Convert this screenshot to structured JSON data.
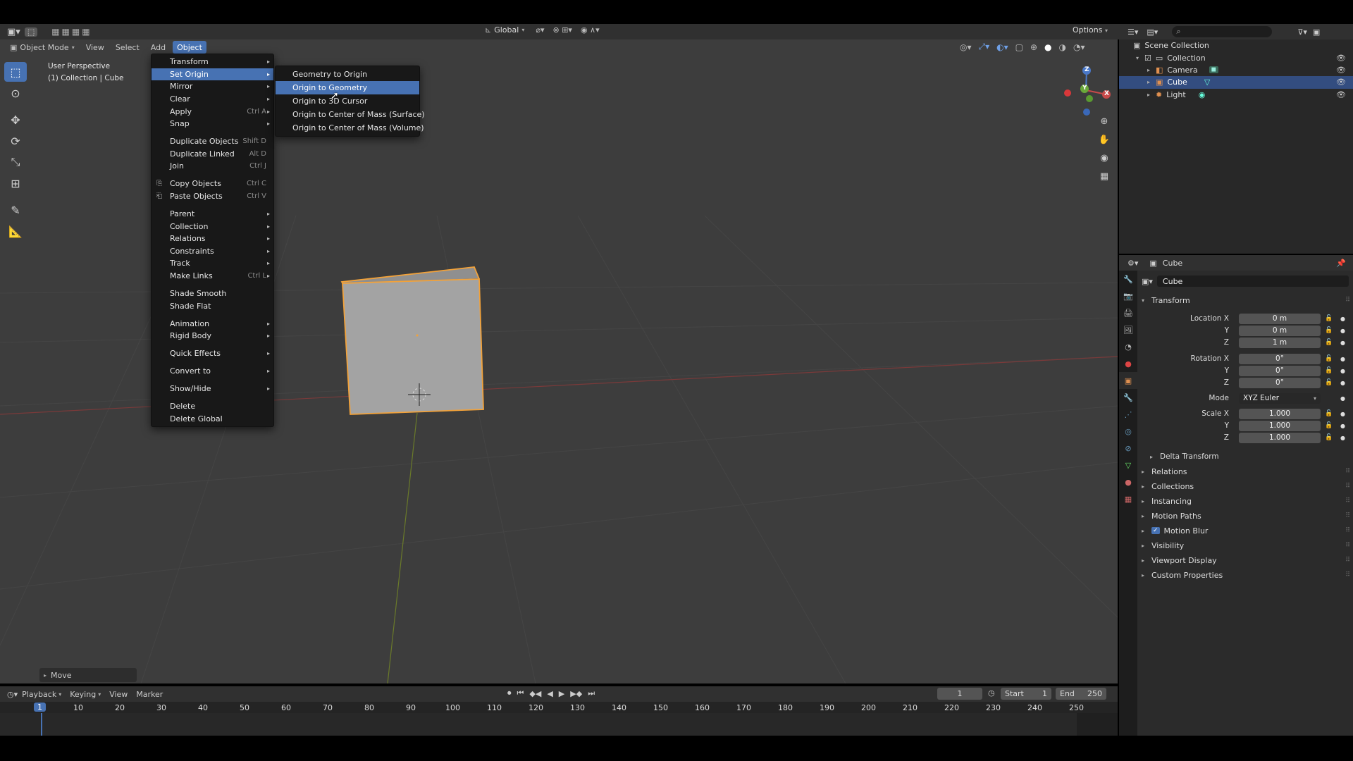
{
  "viewport": {
    "mode_label": "Object Mode",
    "menus": [
      "View",
      "Select",
      "Add",
      "Object"
    ],
    "transform_orientation": "Global",
    "options_label": "Options",
    "overlay_line1": "User Perspective",
    "overlay_line2": "(1) Collection | Cube",
    "last_operator": "Move",
    "gizmo_axes": {
      "x": "X",
      "y": "Y",
      "z": "Z"
    }
  },
  "object_menu": {
    "items": [
      {
        "label": "Transform",
        "shortcut": "",
        "submenu": true
      },
      {
        "label": "Set Origin",
        "shortcut": "",
        "submenu": true,
        "highlighted": true
      },
      {
        "label": "Mirror",
        "shortcut": "",
        "submenu": true
      },
      {
        "label": "Clear",
        "shortcut": "",
        "submenu": true
      },
      {
        "label": "Apply",
        "shortcut": "Ctrl A",
        "submenu": true
      },
      {
        "label": "Snap",
        "shortcut": "",
        "submenu": true
      },
      {
        "label": "Duplicate Objects",
        "shortcut": "Shift D"
      },
      {
        "label": "Duplicate Linked",
        "shortcut": "Alt D"
      },
      {
        "label": "Join",
        "shortcut": "Ctrl J"
      },
      {
        "label": "Copy Objects",
        "shortcut": "Ctrl C"
      },
      {
        "label": "Paste Objects",
        "shortcut": "Ctrl V"
      },
      {
        "label": "Parent",
        "shortcut": "",
        "submenu": true
      },
      {
        "label": "Collection",
        "shortcut": "",
        "submenu": true
      },
      {
        "label": "Relations",
        "shortcut": "",
        "submenu": true
      },
      {
        "label": "Constraints",
        "shortcut": "",
        "submenu": true
      },
      {
        "label": "Track",
        "shortcut": "",
        "submenu": true
      },
      {
        "label": "Make Links",
        "shortcut": "Ctrl L",
        "submenu": true
      },
      {
        "label": "Shade Smooth",
        "shortcut": ""
      },
      {
        "label": "Shade Flat",
        "shortcut": ""
      },
      {
        "label": "Animation",
        "shortcut": "",
        "submenu": true
      },
      {
        "label": "Rigid Body",
        "shortcut": "",
        "submenu": true
      },
      {
        "label": "Quick Effects",
        "shortcut": "",
        "submenu": true
      },
      {
        "label": "Convert to",
        "shortcut": "",
        "submenu": true
      },
      {
        "label": "Show/Hide",
        "shortcut": "",
        "submenu": true
      },
      {
        "label": "Delete",
        "shortcut": ""
      },
      {
        "label": "Delete Global",
        "shortcut": ""
      }
    ]
  },
  "set_origin_menu": {
    "items": [
      {
        "label": "Geometry to Origin"
      },
      {
        "label": "Origin to Geometry",
        "highlighted": true
      },
      {
        "label": "Origin to 3D Cursor"
      },
      {
        "label": "Origin to Center of Mass (Surface)"
      },
      {
        "label": "Origin to Center of Mass (Volume)"
      }
    ]
  },
  "outliner": {
    "root": "Scene Collection",
    "collection": "Collection",
    "objects": [
      {
        "label": "Camera",
        "selected": false
      },
      {
        "label": "Cube",
        "selected": true
      },
      {
        "label": "Light",
        "selected": false
      }
    ]
  },
  "properties": {
    "header_object": "Cube",
    "name_field": "Cube",
    "transform_panel": "Transform",
    "location_label": "Location X",
    "rotation_label": "Rotation X",
    "scale_label": "Scale X",
    "y_label": "Y",
    "z_label": "Z",
    "mode_label": "Mode",
    "location": [
      "0 m",
      "0 m",
      "1 m"
    ],
    "rotation": [
      "0°",
      "0°",
      "0°"
    ],
    "rotation_mode": "XYZ Euler",
    "scale": [
      "1.000",
      "1.000",
      "1.000"
    ],
    "delta_transform": "Delta Transform",
    "panels": [
      "Relations",
      "Collections",
      "Instancing",
      "Motion Paths",
      "Motion Blur",
      "Visibility",
      "Viewport Display",
      "Custom Properties"
    ]
  },
  "timeline": {
    "menus": [
      "Playback",
      "Keying",
      "View",
      "Marker"
    ],
    "current_frame": "1",
    "start_label": "Start",
    "start": "1",
    "end_label": "End",
    "end": "250",
    "ticks": [
      "1",
      "10",
      "20",
      "30",
      "40",
      "50",
      "60",
      "70",
      "80",
      "90",
      "100",
      "110",
      "120",
      "130",
      "140",
      "150",
      "160",
      "170",
      "180",
      "190",
      "200",
      "210",
      "220",
      "230",
      "240",
      "250"
    ]
  },
  "colors": {
    "accent": "#4772b3",
    "selection_outline": "#f2a23a",
    "viewport_bg": "#3d3d3d"
  }
}
